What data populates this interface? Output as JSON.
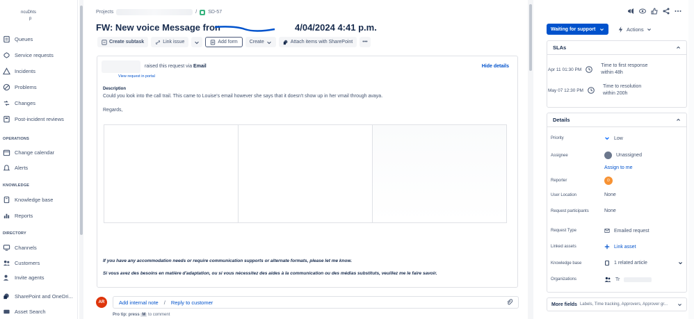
{
  "sidebar": {
    "project_name": "ncuDhts",
    "project_sub": "p",
    "items": [
      {
        "label": "Queues",
        "icon": "queue-icon"
      },
      {
        "label": "Service requests",
        "icon": "service-request-icon"
      },
      {
        "label": "Incidents",
        "icon": "incident-icon"
      },
      {
        "label": "Problems",
        "icon": "problem-icon"
      },
      {
        "label": "Changes",
        "icon": "change-icon"
      },
      {
        "label": "Post-incident reviews",
        "icon": "review-icon"
      }
    ],
    "sections": [
      {
        "title": "OPERATIONS",
        "items": [
          {
            "label": "Change calendar",
            "icon": "calendar-icon"
          },
          {
            "label": "Alerts",
            "icon": "bell-icon"
          }
        ]
      },
      {
        "title": "KNOWLEDGE",
        "items": [
          {
            "label": "Knowledge base",
            "icon": "book-icon"
          },
          {
            "label": "Reports",
            "icon": "chart-icon"
          }
        ]
      },
      {
        "title": "DIRECTORY",
        "items": [
          {
            "label": "Channels",
            "icon": "monitor-icon"
          },
          {
            "label": "Customers",
            "icon": "people-icon"
          },
          {
            "label": "Invite agents",
            "icon": "person-add-icon"
          }
        ]
      },
      {
        "title": "",
        "items": [
          {
            "label": "SharePoint and OneDri...",
            "icon": "sharepoint-icon"
          },
          {
            "label": "Asset Search",
            "icon": "asset-icon"
          }
        ]
      }
    ]
  },
  "breadcrumb": {
    "root": "Projects",
    "separator": "/",
    "issue_key": "SD-57"
  },
  "issue": {
    "title_start": "FW: New voice Message fron",
    "title_end": "4/04/2024 4:41 p.m."
  },
  "toolbar": {
    "create_subtask": "Create subtask",
    "link_issue": "Link issue",
    "add_form": "Add form",
    "create": "Create",
    "attach_sharepoint": "Attach items with SharePoint",
    "more": "•••"
  },
  "request": {
    "raised_text": "raised this request via",
    "raised_channel": "Email",
    "view_portal": "View request in portal",
    "hide_details": "Hide details",
    "description_label": "Description",
    "description_text": "Could you look into the call trail. This came to Louise's email however she says that it doesn't show up in her vmail through avaya.",
    "regards": "Regards,",
    "note_en": "If you have any accommodation needs or require communication supports or alternate formats, please let me know.",
    "note_fr": "Si vous avez des besoins en matière d'adaptation, ou si vous nécessitez des aides à la communication ou des médias substituts, veuillez me le faire savoir."
  },
  "comment": {
    "avatar_initials": "AR",
    "add_internal_note": "Add internal note",
    "separator": "/",
    "reply_to_customer": "Reply to customer",
    "protip_prefix": "Pro tip: press",
    "protip_key": "M",
    "protip_suffix": "to comment"
  },
  "right_panel": {
    "status": "Waiting for support",
    "actions": "Actions",
    "slas": {
      "title": "SLAs",
      "items": [
        {
          "date": "Apr 11 01:30 PM",
          "goal": "Time to first response",
          "within": "within 48h"
        },
        {
          "date": "May 07 12:30 PM",
          "goal": "Time to resolution",
          "within": "within 200h"
        }
      ]
    },
    "details": {
      "title": "Details",
      "priority_label": "Priority",
      "priority_value": "Low",
      "assignee_label": "Assignee",
      "assignee_value": "Unassigned",
      "assign_to_me": "Assign to me",
      "reporter_label": "Reporter",
      "reporter_initial": "D",
      "user_location_label": "User Location",
      "user_location_value": "None",
      "participants_label": "Request participants",
      "participants_value": "None",
      "request_type_label": "Request Type",
      "request_type_value": "Emailed request",
      "linked_assets_label": "Linked assets",
      "linked_assets_value": "Link asset",
      "kb_label": "Knowledge base",
      "kb_value": "1 related article",
      "org_label": "Organizations",
      "org_value": "Tr"
    },
    "more_fields": "More fields",
    "more_fields_desc": "Labels, Time tracking, Approvers, Approver gr..."
  }
}
